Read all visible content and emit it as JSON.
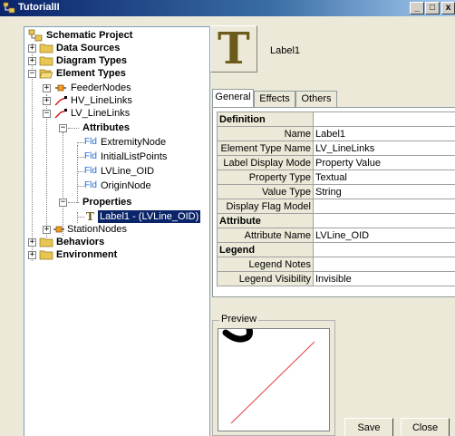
{
  "window": {
    "title": "TutorialII",
    "minimize_glyph": "_",
    "maximize_glyph": "□",
    "close_glyph": "x"
  },
  "tree": {
    "root": "Schematic Project",
    "data_sources": "Data Sources",
    "diagram_types": "Diagram Types",
    "element_types": "Element Types",
    "feeder_nodes": "FeederNodes",
    "hv_linelinks": "HV_LineLinks",
    "lv_linelinks": "LV_LineLinks",
    "attributes": "Attributes",
    "fld_prefix": "Fld",
    "attr_items": [
      "ExtremityNode",
      "InitialListPoints",
      "LVLine_OID",
      "OriginNode"
    ],
    "properties": "Properties",
    "label1": "Label1 - (LVLine_OID)",
    "station_nodes": "StationNodes",
    "behaviors": "Behaviors",
    "environment": "Environment"
  },
  "header": {
    "big_glyph": "T",
    "label": "Label1"
  },
  "tabs": [
    "General",
    "Effects",
    "Others"
  ],
  "grid": {
    "definition": "Definition",
    "rows_def": [
      {
        "k": "Name",
        "v": "Label1"
      },
      {
        "k": "Element Type Name",
        "v": "LV_LineLinks"
      },
      {
        "k": "Label Display Mode",
        "v": "Property Value"
      },
      {
        "k": "Property Type",
        "v": "Textual"
      },
      {
        "k": "Value Type",
        "v": "String"
      },
      {
        "k": "Display Flag Model",
        "v": ""
      }
    ],
    "attribute": "Attribute",
    "rows_attr": [
      {
        "k": "Attribute Name",
        "v": "LVLine_OID"
      }
    ],
    "legend": "Legend",
    "rows_legend": [
      {
        "k": "Legend Notes",
        "v": ""
      },
      {
        "k": "Legend Visibility",
        "v": "Invisible"
      }
    ]
  },
  "preview": {
    "label": "Preview"
  },
  "buttons": {
    "save": "Save",
    "close": "Close"
  },
  "colors": {
    "title_bar": "#0a246a",
    "selection": "#0a246a",
    "folder": "#e8c652",
    "line_link": "#d02020",
    "fld": "#1d6bd6"
  }
}
